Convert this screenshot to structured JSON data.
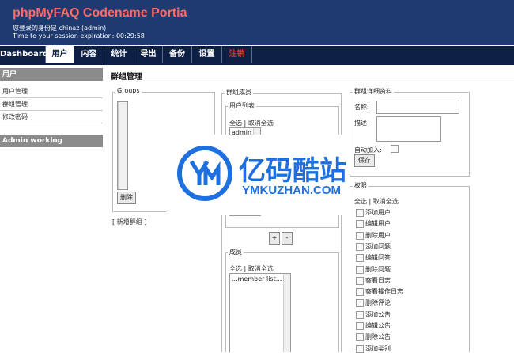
{
  "app": {
    "title": "phpMyFAQ Codename Portia",
    "logged_in_as": "您登录的身份是 chinaz (admin)",
    "session_expiration": "Time to your session expiration: 00:29:58"
  },
  "nav": {
    "tabs": [
      {
        "label": "Dashboard"
      },
      {
        "label": "用户"
      },
      {
        "label": "内容"
      },
      {
        "label": "统计"
      },
      {
        "label": "导出"
      },
      {
        "label": "备份"
      },
      {
        "label": "设置"
      },
      {
        "label": "注销"
      }
    ],
    "active_index": 1
  },
  "sidebar": {
    "section_title": "用户",
    "items": [
      {
        "label": "用户管理"
      },
      {
        "label": "群组管理"
      },
      {
        "label": "修改密码"
      }
    ],
    "worklog_title": "Admin worklog"
  },
  "main": {
    "title": "群组管理",
    "groups": {
      "legend": "Groups",
      "delete_button": "删除",
      "add_group_link": "新增群组",
      "bracket_open": "[",
      "bracket_close": "]"
    },
    "members": {
      "legend": "群组成员",
      "user_list_legend": "用户列表",
      "select_all": "全选",
      "separator": "|",
      "deselect_all": "取消全选",
      "user_list_items": [
        "admin"
      ],
      "add_button": "+",
      "remove_button": "-",
      "members_legend": "成员",
      "members_select_all": "全选",
      "members_deselect_all": "取消全选",
      "member_list_placeholder": "...member list..."
    },
    "details": {
      "legend": "群组详细资料",
      "name_label": "名称:",
      "desc_label": "描述:",
      "auto_join_label": "自动加入:",
      "save_button": "保存"
    },
    "permissions": {
      "legend": "权限",
      "select_all": "全选",
      "separator": "|",
      "deselect_all": "取消全选",
      "items": [
        "添加用户",
        "编辑用户",
        "删除用户",
        "添加问题",
        "编辑问答",
        "删除问题",
        "察看日志",
        "察看操作日志",
        "删除评论",
        "添加公告",
        "编辑公告",
        "删除公告",
        "添加类别"
      ]
    }
  },
  "watermark": {
    "text_cn": "亿码酷站",
    "text_en": "YMKUZHAN.COM"
  }
}
